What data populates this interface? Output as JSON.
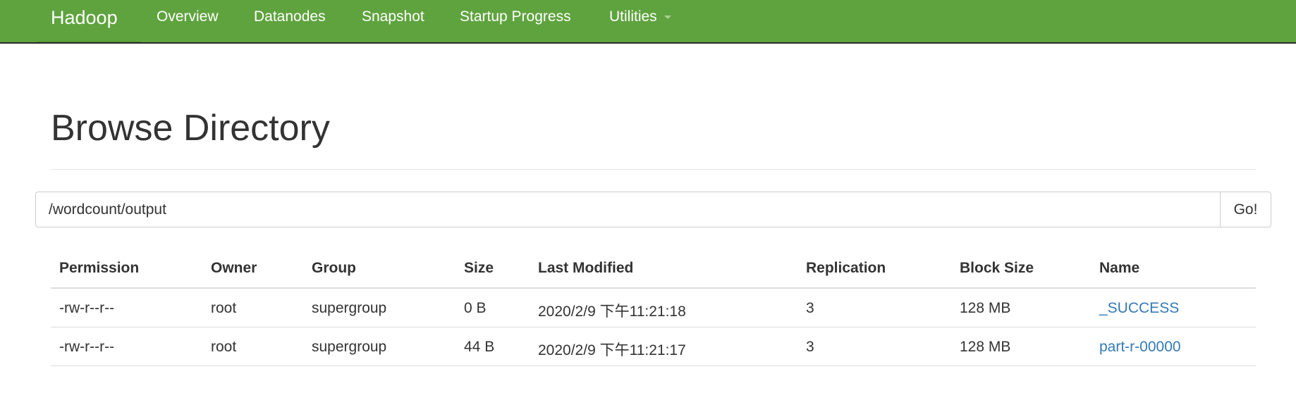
{
  "navbar": {
    "brand": "Hadoop",
    "items": [
      {
        "label": "Overview"
      },
      {
        "label": "Datanodes"
      },
      {
        "label": "Snapshot"
      },
      {
        "label": "Startup Progress"
      },
      {
        "label": "Utilities"
      }
    ],
    "color": "#5fa33e"
  },
  "page": {
    "title": "Browse Directory"
  },
  "path_bar": {
    "value": "/wordcount/output",
    "go_label": "Go!"
  },
  "table": {
    "headers": [
      "Permission",
      "Owner",
      "Group",
      "Size",
      "Last Modified",
      "Replication",
      "Block Size",
      "Name"
    ],
    "rows": [
      [
        "-rw-r--r--",
        "root",
        "supergroup",
        "0 B",
        "2020/2/9 下午11:21:18",
        "3",
        "128 MB",
        "_SUCCESS"
      ],
      [
        "-rw-r--r--",
        "root",
        "supergroup",
        "44 B",
        "2020/2/9 下午11:21:17",
        "3",
        "128 MB",
        "part-r-00000"
      ]
    ],
    "link_color": "#337ab7"
  }
}
